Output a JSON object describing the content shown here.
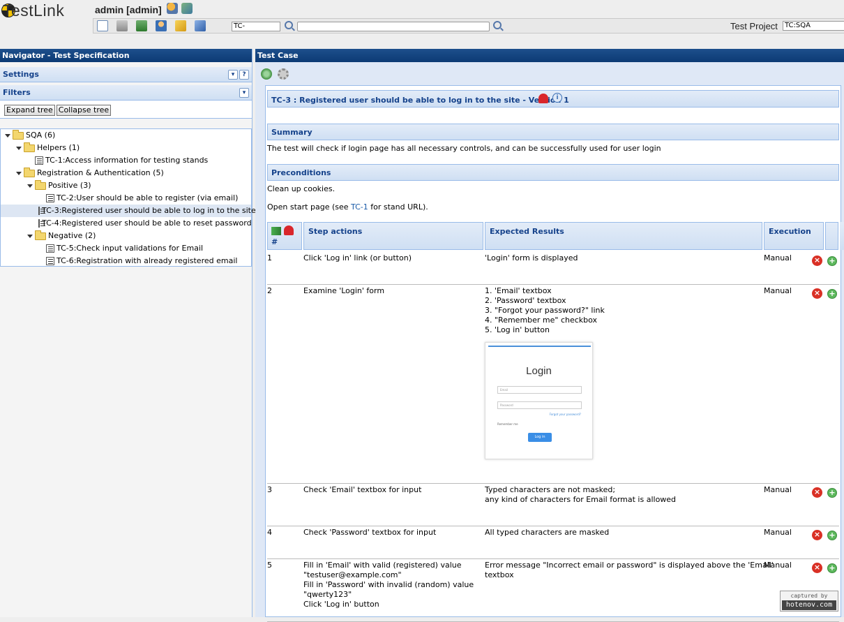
{
  "app": {
    "logo_text": "TestLink",
    "user": "admin [admin]"
  },
  "toolbar": {
    "icons": [
      "home-icon",
      "cart-icon",
      "sitemap-icon",
      "user-icon",
      "bell-icon",
      "pencil-icon"
    ],
    "tc_id_value": "TC-",
    "search_value": "",
    "project_label": "Test Project",
    "project_value": "TC:SQA"
  },
  "navigator": {
    "title": "Navigator - Test Specification",
    "settings_label": "Settings",
    "filters_label": "Filters",
    "expand_label": "Expand tree",
    "collapse_label": "Collapse tree",
    "tree": [
      {
        "label": "SQA (6)",
        "type": "folder",
        "expanded": true
      },
      {
        "label": "Helpers (1)",
        "type": "folder",
        "expanded": true
      },
      {
        "label": "TC-1:Access information for testing stands",
        "type": "case"
      },
      {
        "label": "Registration & Authentication (5)",
        "type": "folder",
        "expanded": true
      },
      {
        "label": "Positive (3)",
        "type": "folder",
        "expanded": true
      },
      {
        "label": "TC-2:User should be able to register (via email)",
        "type": "case"
      },
      {
        "label": "TC-3:Registered user should be able to log in to the site",
        "type": "case",
        "selected": true
      },
      {
        "label": "TC-4:Registered user should be able to reset password",
        "type": "case"
      },
      {
        "label": "Negative (2)",
        "type": "folder",
        "expanded": true
      },
      {
        "label": "TC-5:Check input validations for Email",
        "type": "case"
      },
      {
        "label": "TC-6:Registration with already registered email",
        "type": "case"
      }
    ]
  },
  "testcase": {
    "panel_title": "Test Case",
    "title": "TC-3 : Registered user should be able to log in to the site - Version 1",
    "summary_label": "Summary",
    "summary_text": "The test will check if login page has all necessary controls, and can be successfully used for user login",
    "preconditions_label": "Preconditions",
    "precond_line1": "Clean up cookies.",
    "precond_line2_pre": "Open start page (see ",
    "precond_link": "TC-1",
    "precond_line2_post": " for stand URL).",
    "columns": {
      "num": "#",
      "actions": "Step actions",
      "expected": "Expected Results",
      "execution": "Execution"
    },
    "steps": [
      {
        "num": "1",
        "actions": [
          "Click 'Log in' link (or button)"
        ],
        "expected": [
          "'Login' form is displayed"
        ],
        "execution": "Manual"
      },
      {
        "num": "2",
        "actions": [
          "Examine 'Login' form"
        ],
        "expected": [
          "1. 'Email' textbox",
          "2. 'Password' textbox",
          "3. \"Forgot your password?\" link",
          "4. \"Remember me\" checkbox",
          "5. 'Log in' button"
        ],
        "execution": "Manual"
      },
      {
        "num": "3",
        "actions": [
          "Check 'Email' textbox for input"
        ],
        "expected": [
          "Typed characters are not masked;",
          "any kind of characters for Email format is allowed"
        ],
        "execution": "Manual"
      },
      {
        "num": "4",
        "actions": [
          "Check 'Password' textbox for input"
        ],
        "expected": [
          "All typed characters are masked"
        ],
        "execution": "Manual"
      },
      {
        "num": "5",
        "actions": [
          "Fill in 'Email' with valid (registered) value",
          "\"testuser@example.com\"",
          "Fill in 'Password' with invalid (random) value",
          "\"qwerty123\"",
          "Click 'Log in' button"
        ],
        "expected": [
          "Error message \"Incorrect email or password\" is displayed above the 'Email'",
          "textbox"
        ],
        "execution": "Manual"
      }
    ],
    "login_screenshot": {
      "title": "Login",
      "email_placeholder": "Email",
      "password_placeholder": "Password",
      "forgot_link": "Forgot your password?",
      "remember_label": "Remember me",
      "button_label": "Log in"
    }
  },
  "watermark": {
    "top": "captured by",
    "bottom": "hotenov.com"
  },
  "colors": {
    "header_blue": "#0c3a74",
    "panel_text": "#15428b",
    "delete_red": "#d93025",
    "add_green": "#5cb85c"
  }
}
